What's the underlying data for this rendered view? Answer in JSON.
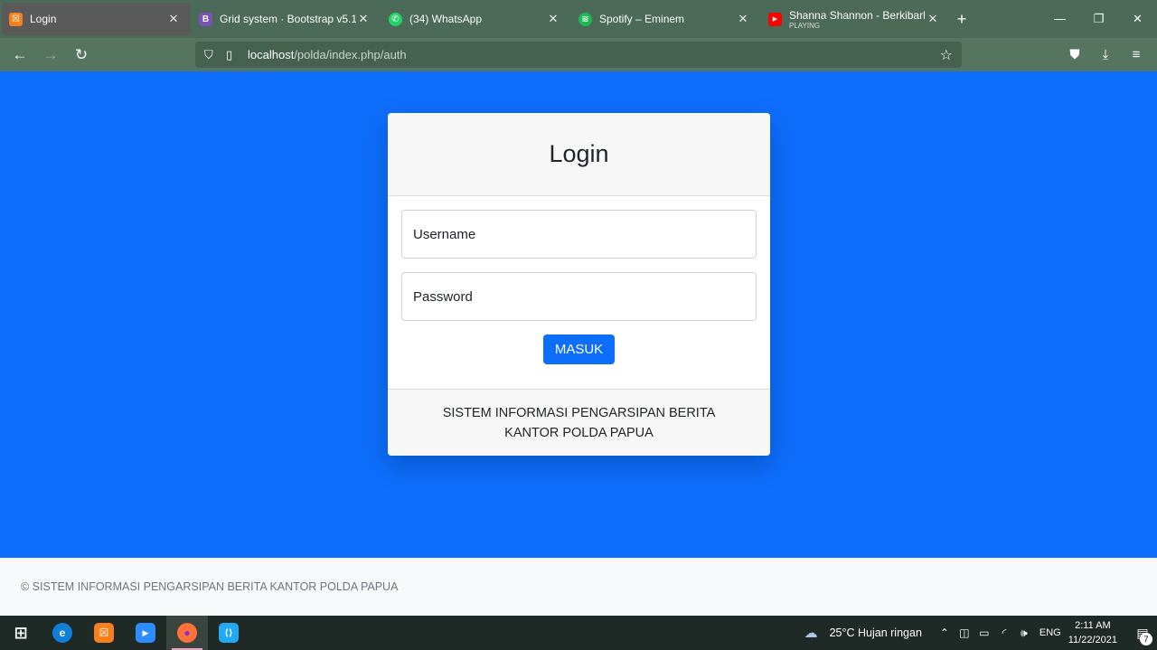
{
  "browser": {
    "tabs": [
      {
        "title": "Login",
        "favicon_color": "#f77f1d",
        "favicon_glyph": "☒",
        "active": true
      },
      {
        "title": "Grid system · Bootstrap v5.1",
        "favicon_color": "#7952b3",
        "favicon_glyph": "B",
        "active": false
      },
      {
        "title": "(34) WhatsApp",
        "favicon_color": "#25d366",
        "favicon_glyph": "✆",
        "active": false
      },
      {
        "title": "Spotify – Eminem",
        "favicon_color": "#1db954",
        "favicon_glyph": "≋",
        "active": false
      },
      {
        "title": "Shanna Shannon - Berkibarlah B",
        "subtitle": "PLAYING",
        "favicon_color": "#ff0000",
        "favicon_glyph": "▶",
        "active": false
      }
    ],
    "url_host": "localhost",
    "url_path": "/polda/index.php/auth"
  },
  "login": {
    "title": "Login",
    "username_label": "Username",
    "password_label": "Password",
    "submit_label": "MASUK",
    "card_footer": "SISTEM INFORMASI PENGARSIPAN BERITA KANTOR POLDA PAPUA"
  },
  "footer": {
    "text": "© SISTEM INFORMASI PENGARSIPAN BERITA KANTOR POLDA PAPUA"
  },
  "taskbar": {
    "apps": [
      {
        "name": "windows-start",
        "color": "#1f2a26",
        "glyph": "⊞"
      },
      {
        "name": "edge",
        "color": "#0f7fd8",
        "glyph": "e"
      },
      {
        "name": "xampp",
        "color": "#f77f1d",
        "glyph": "☒"
      },
      {
        "name": "zoom",
        "color": "#2d8cff",
        "glyph": "▶"
      },
      {
        "name": "firefox",
        "color": "#ff7139",
        "glyph": "●"
      },
      {
        "name": "vscode",
        "color": "#23a9f2",
        "glyph": "⟨⟩"
      }
    ],
    "weather": "25°C  Hujan ringan",
    "language": "ENG",
    "time": "2:11 AM",
    "date": "11/22/2021",
    "notification_count": "7"
  },
  "colors": {
    "primary": "#0d6efd",
    "tabbar": "#4b6a57",
    "navbar": "#557560"
  }
}
